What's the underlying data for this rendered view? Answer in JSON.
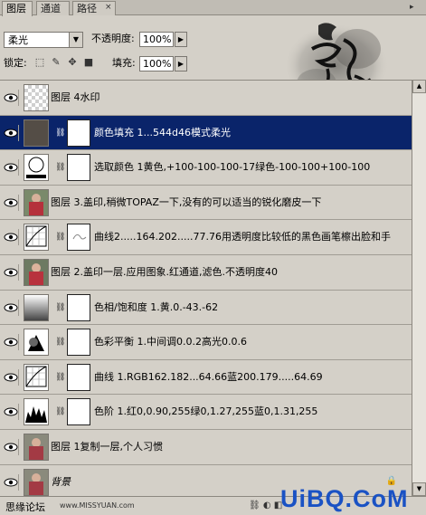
{
  "tabs": [
    {
      "label": "图层"
    },
    {
      "label": "通道"
    },
    {
      "label": "路径"
    }
  ],
  "tab_close": "×",
  "panel_menu": "▸",
  "blend_mode": "柔光",
  "opacity_label": "不透明度:",
  "opacity_value": "100%",
  "lock_label": "锁定:",
  "fill_label": "填充:",
  "fill_value": "100%",
  "layers": [
    {
      "name": "图层 4水印"
    },
    {
      "name": "颜色填充 1...544d46模式柔光"
    },
    {
      "name": "选取颜色 1黄色,+100-100-100-17绿色-100-100+100-100"
    },
    {
      "name": "图层 3.盖印,稍微TOPAZ一下,没有的可以适当的锐化磨皮一下"
    },
    {
      "name": "曲线2.....164.202.....77.76用透明度比较低的黑色画笔檫出脸和手"
    },
    {
      "name": "图层 2.盖印一层.应用图象.红通道,滤色.不透明度40"
    },
    {
      "name": "色相/饱和度 1.黄.0.-43.-62"
    },
    {
      "name": "色彩平衡 1.中间调0.0.2高光0.0.6"
    },
    {
      "name": "曲线 1.RGB162.182...64.66蓝200.179.....64.69"
    },
    {
      "name": "色阶 1.红0,0.90,255绿0,1.27,255蓝0,1.31,255"
    },
    {
      "name": "图层 1复制一层,个人习惯"
    },
    {
      "name": "背景"
    }
  ],
  "footer": {
    "credit": "思缘论坛",
    "url": "www.MISSYUAN.com",
    "brand": "UiBQ.CoM"
  },
  "colors": {
    "fill_swatch": "#544d46",
    "selected_row": "#0a246a",
    "brand": "#1a52c4"
  }
}
